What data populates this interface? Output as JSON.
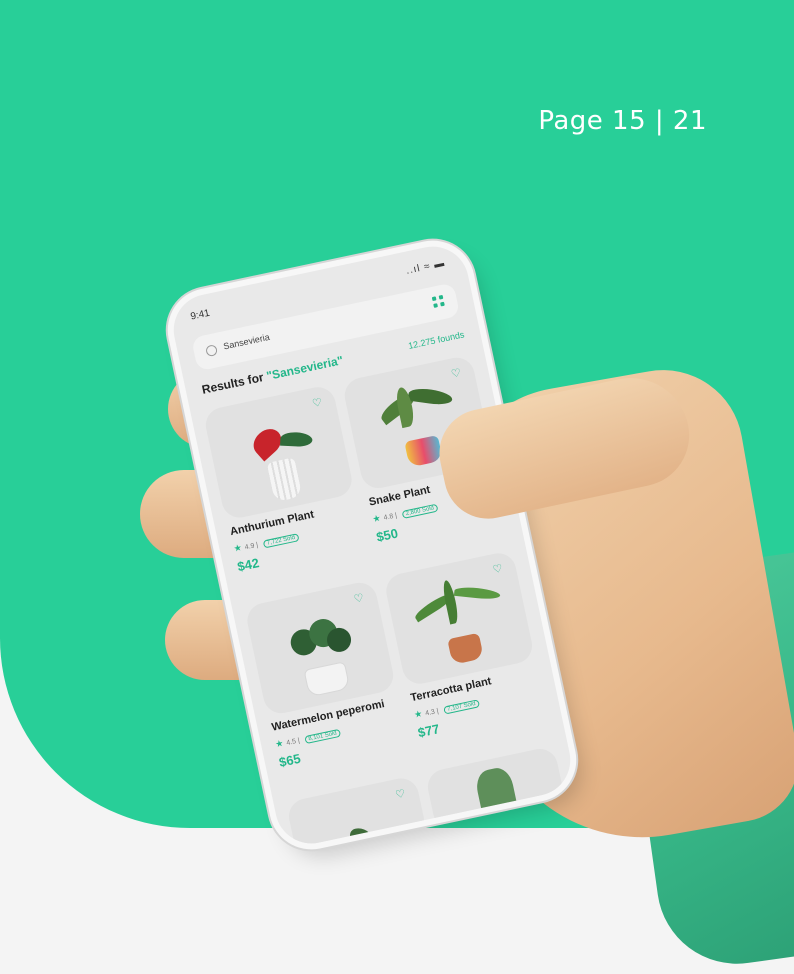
{
  "page_number": "Page 15 | 21",
  "colors": {
    "brand_green": "#28cf98",
    "accent": "#23b78a"
  },
  "phone": {
    "status_time": "9:41",
    "status_indicators": "..ıl ≈ ▬",
    "search": {
      "value": "Sansevieria"
    },
    "results": {
      "prefix": "Results for ",
      "query": "\"Sansevieria\"",
      "count": "12.275 founds"
    },
    "products": [
      {
        "name": "Anthurium Plant",
        "rating": "4.9",
        "sold": "7,722 Sold",
        "price": "$42"
      },
      {
        "name": "Snake Plant",
        "rating": "4.8",
        "sold": "2,800 Sold",
        "price": "$50"
      },
      {
        "name": "Watermelon peperomi",
        "rating": "4.5",
        "sold": "8,101 Sold",
        "price": "$65"
      },
      {
        "name": "Terracotta plant",
        "rating": "4.3",
        "sold": "7,107 Sold",
        "price": "$77"
      }
    ]
  }
}
